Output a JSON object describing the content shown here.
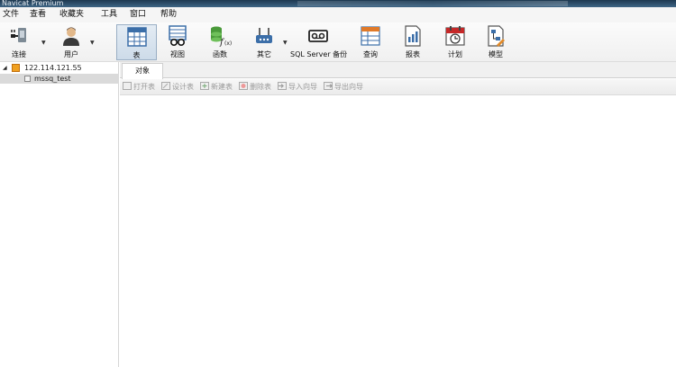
{
  "window": {
    "title": "Navicat Premium"
  },
  "menu": [
    "文件",
    "查看",
    "收藏夹",
    "工具",
    "窗口",
    "帮助"
  ],
  "toolbar": {
    "connect": "连接",
    "user": "用户",
    "table": "表",
    "view": "视图",
    "function": "函数",
    "other": "其它",
    "backup": "SQL Server 备份",
    "query": "查询",
    "report": "报表",
    "schedule": "计划",
    "model": "模型"
  },
  "tree": {
    "server": "122.114.121.55",
    "database": "mssq_test"
  },
  "tabs": {
    "objects": "对象"
  },
  "objbar": {
    "open": "打开表",
    "design": "设计表",
    "new": "新建表",
    "delete": "删除表",
    "import": "导入向导",
    "export": "导出向导"
  },
  "colors": {
    "accent": "#99aec4",
    "titlebar": "#2b4a66"
  }
}
